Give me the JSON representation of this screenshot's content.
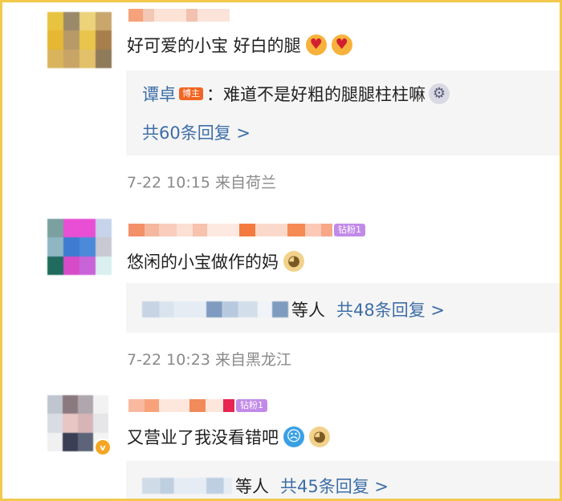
{
  "comments": [
    {
      "text": "好可爱的小宝 好白的腿",
      "emojis": [
        "heart-eyes-icon",
        "heart-eyes-icon"
      ],
      "reply": {
        "author": "谭卓",
        "author_badge": "博主",
        "separator": "：",
        "text": "难道不是好粗的腿腿柱柱嘛",
        "emoji": "robot-icon",
        "more": "共60条回复 >"
      },
      "meta": "7-22 10:15 来自荷兰"
    },
    {
      "fan_badge": "钻粉1",
      "text": "悠闲的小宝做作的妈",
      "emojis": [
        "doge-icon"
      ],
      "reply": {
        "others_suffix": "等人",
        "more": "共48条回复 >"
      },
      "meta": "7-22 10:23 来自黑龙江"
    },
    {
      "fan_badge": "钻粉1",
      "avatar_verified": "v",
      "text": "又营业了我没看错吧",
      "emojis": [
        "blue-face-icon",
        "doge-icon"
      ],
      "reply": {
        "others_suffix": "等人",
        "more": "共45条回复 >"
      }
    }
  ],
  "colors": {
    "link": "#3d6ea8",
    "reply_bg": "#f5f5f5",
    "meta_text": "#8a8a8a",
    "frame_border": "#f2c94c",
    "host_badge": "#f26522",
    "fan_badge": "#c28ae8"
  }
}
